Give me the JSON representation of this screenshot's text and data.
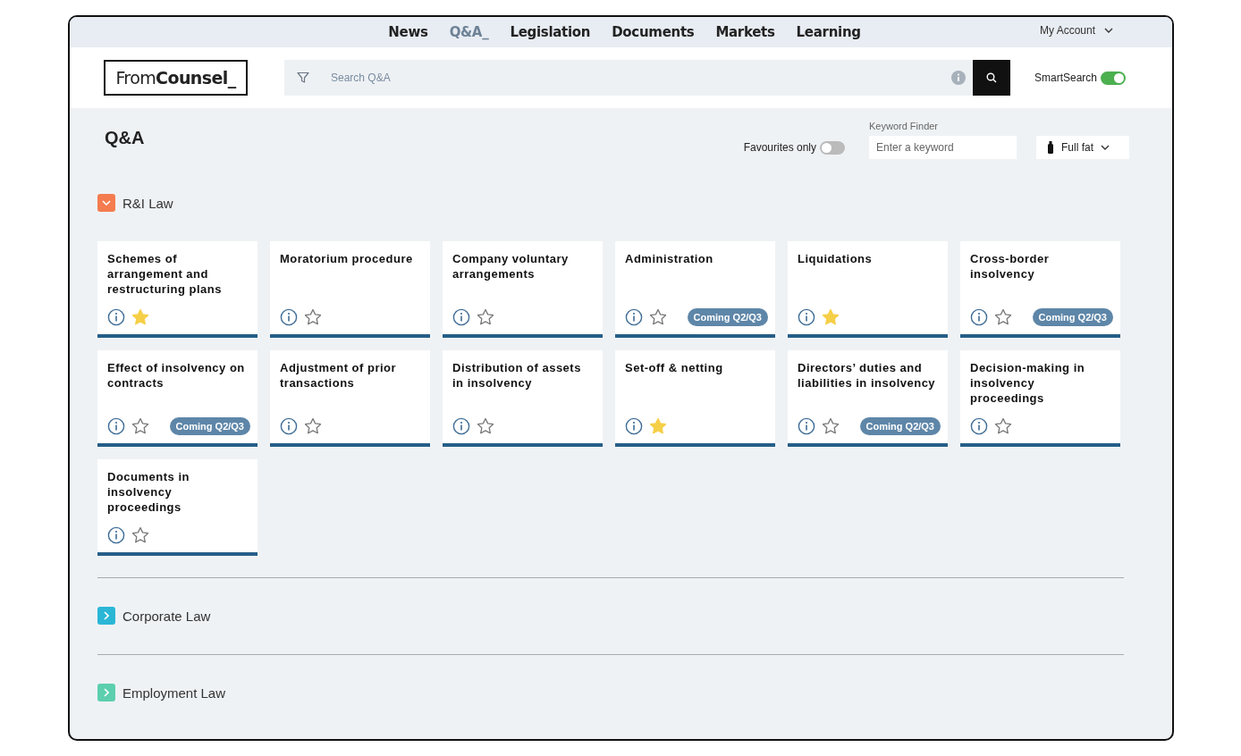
{
  "nav": {
    "items": [
      {
        "label": "News",
        "selected": false
      },
      {
        "label": "Q&A_",
        "selected": true
      },
      {
        "label": "Legislation",
        "selected": false
      },
      {
        "label": "Documents",
        "selected": false
      },
      {
        "label": "Markets",
        "selected": false
      },
      {
        "label": "Learning",
        "selected": false
      }
    ],
    "account": "My Account"
  },
  "header": {
    "logo": "From**Counsel_**",
    "search": {
      "placeholder": "Search Q&A"
    },
    "smart_search": {
      "label": "SmartSearch",
      "on": true
    }
  },
  "page": {
    "title": "Q&A",
    "favourites_only": {
      "label": "Favourites only",
      "on": false
    },
    "keyword_finder": {
      "label": "Keyword Finder",
      "placeholder": "Enter a keyword"
    },
    "mode": "Full fat"
  },
  "sections": [
    {
      "title": "R&I Law",
      "color": "#f47c4f",
      "expanded": true,
      "cards": [
        {
          "title": "Schemes of arrangement and restructuring plans",
          "favourite": true
        },
        {
          "title": "Moratorium procedure",
          "favourite": false
        },
        {
          "title": "Company voluntary arrangements",
          "favourite": false
        },
        {
          "title": "Administration",
          "favourite": false,
          "badge": "Coming Q2/Q3"
        },
        {
          "title": "Liquidations",
          "favourite": true
        },
        {
          "title": "Cross-border insolvency",
          "favourite": false,
          "badge": "Coming Q2/Q3"
        },
        {
          "title": "Effect of insolvency on contracts",
          "favourite": false,
          "badge": "Coming Q2/Q3"
        },
        {
          "title": "Adjustment of prior transactions",
          "favourite": false
        },
        {
          "title": "Distribution of assets in insolvency",
          "favourite": false
        },
        {
          "title": "Set-off & netting",
          "favourite": true
        },
        {
          "title": "Directors’ duties and liabilities in insolvency",
          "favourite": false,
          "badge": "Coming Q2/Q3"
        },
        {
          "title": "Decision-making in insolvency proceedings",
          "favourite": false
        },
        {
          "title": "Documents in insolvency proceedings",
          "favourite": false
        }
      ]
    },
    {
      "title": "Corporate Law",
      "color": "#2bb6d6",
      "expanded": false
    },
    {
      "title": "Employment Law",
      "color": "#5ccfae",
      "expanded": false
    }
  ]
}
